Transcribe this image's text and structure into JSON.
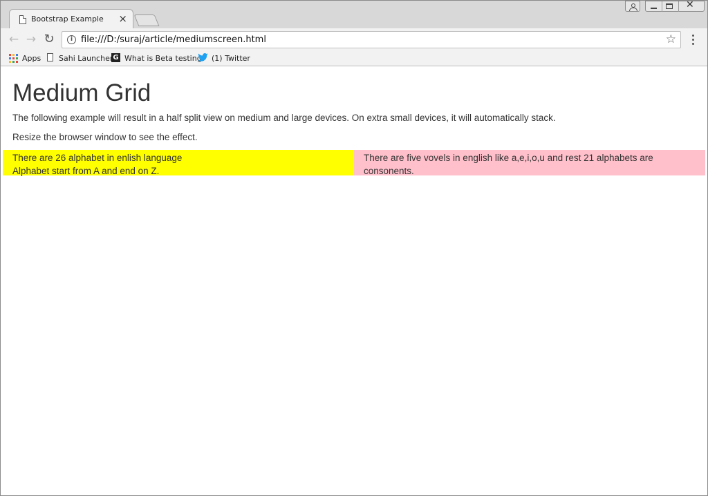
{
  "browser": {
    "tab_title": "Bootstrap Example",
    "tab_close": "×",
    "url": "file:///D:/suraj/article/mediumscreen.html",
    "bookmarks": [
      {
        "label": "Apps",
        "icon": "apps-grid-icon"
      },
      {
        "label": "Sahi Launcher",
        "icon": "page-icon"
      },
      {
        "label": "What is Beta testing?",
        "icon": "g-icon"
      },
      {
        "label": "(1) Twitter",
        "icon": "twitter-bird-icon"
      }
    ],
    "window_close": "✕"
  },
  "page": {
    "title": "Medium Grid",
    "paragraph1": "The following example will result in a half split view on medium and large devices. On extra small devices, it will automatically stack.",
    "paragraph2": "Resize the browser window to see the effect.",
    "left_col": {
      "line1": "There are 26 alphabet in enlish language",
      "line2": "Alphabet start from A and end on Z.",
      "color": "#ffff00"
    },
    "right_col": {
      "line1": "There are five vovels in english like a,e,i,o,u and rest 21 alphabets are",
      "line2": "consonents.",
      "color": "#ffc0cb"
    }
  }
}
